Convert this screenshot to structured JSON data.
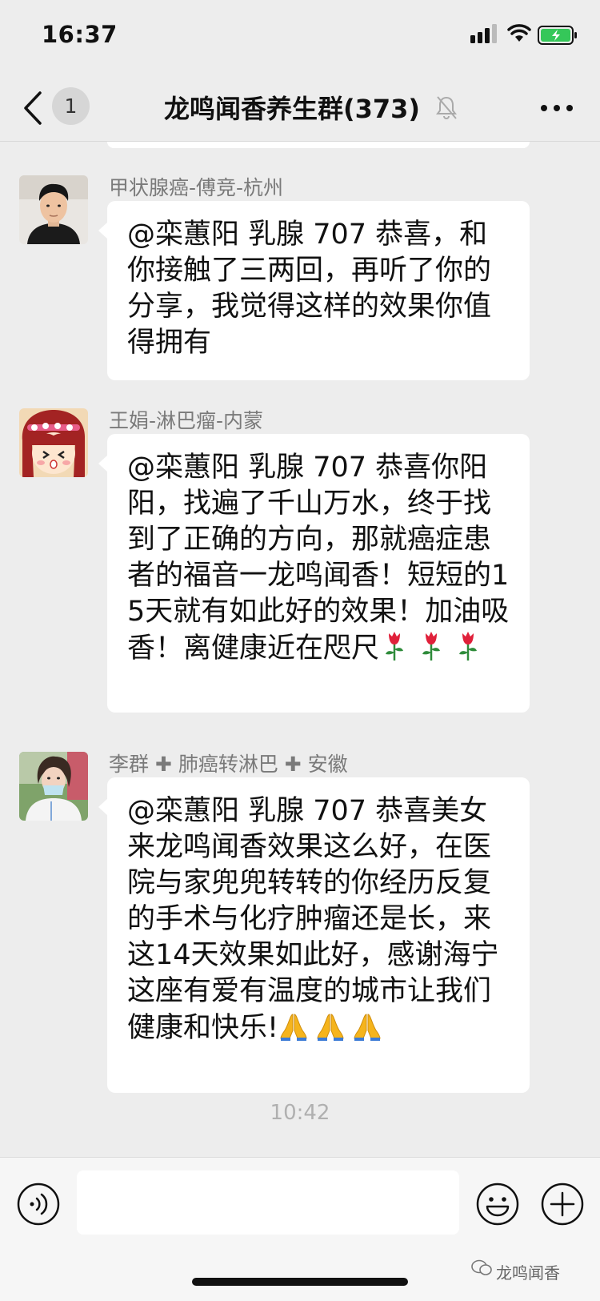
{
  "status_bar": {
    "time": "16:37"
  },
  "nav": {
    "unread_count": "1",
    "title": "龙鸣闻香养生群(373)"
  },
  "messages": [
    {
      "sender": "甲状腺癌-傅竞-杭州",
      "text": "@栾蕙阳 乳腺 707 恭喜，和你接触了三两回，再听了你的分享，我觉得这样的效果你值得拥有"
    },
    {
      "sender": "王娟-淋巴瘤-内蒙",
      "text": "@栾蕙阳 乳腺 707 恭喜你阳阳，找遍了千山万水，终于找到了正确的方向，那就癌症患者的福音一龙鸣闻香！短短的15天就有如此好的效果！加油吸香！离健康近在咫尺",
      "emoji": "rose-emoji"
    },
    {
      "sender": "李群 ✚ 肺癌转淋巴 ✚ 安徽",
      "text": "@栾蕙阳 乳腺 707 恭喜美女来龙鸣闻香效果这么好，在医院与家兜兜转转的你经历反复的手术与化疗肿瘤还是长，来这14天效果如此好，感谢海宁这座有爱有温度的城市让我们健康和快乐!",
      "emoji": "folded-hands-emoji"
    }
  ],
  "time_divider": "10:42",
  "watermark": "龙鸣闻香",
  "colors": {
    "background": "#ededed",
    "bubble": "#ffffff",
    "sender_text": "#7a7a7a",
    "rose": "#e0203a",
    "hands": "#f5b41c"
  }
}
